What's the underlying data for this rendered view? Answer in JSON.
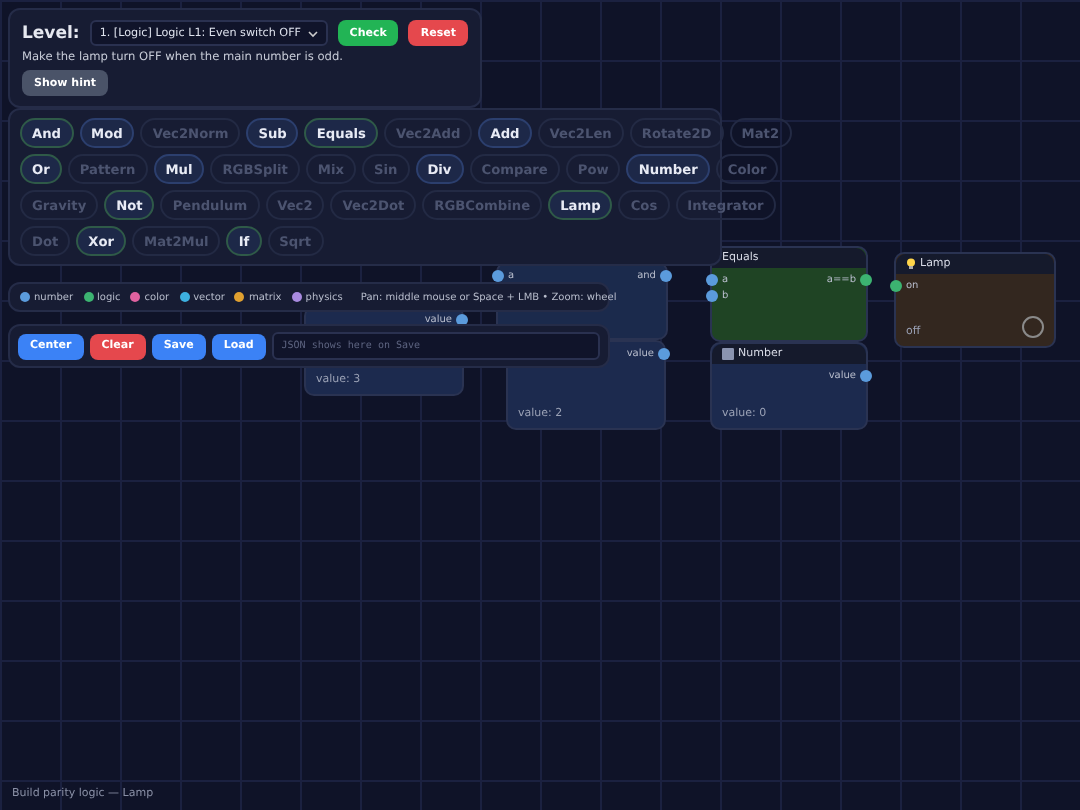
{
  "level": {
    "label": "Level:",
    "selected": "1. [Logic] Logic L1: Even switch OFF",
    "check": "Check",
    "reset": "Reset",
    "task": "Make the lamp turn OFF when the main number is odd.",
    "hint_button": "Show hint"
  },
  "palette": [
    [
      {
        "label": "And",
        "disabled": false,
        "color": "#2f5a48"
      },
      {
        "label": "Mod",
        "disabled": false,
        "color": "#2c3f6e"
      },
      {
        "label": "Vec2Norm",
        "disabled": true
      },
      {
        "label": "Sub",
        "disabled": false,
        "color": "#2c3f6e"
      },
      {
        "label": "Equals",
        "disabled": false,
        "color": "#2f5a48"
      },
      {
        "label": "Vec2Add",
        "disabled": true
      },
      {
        "label": "Add",
        "disabled": false,
        "color": "#2c3f6e"
      },
      {
        "label": "Vec2Len",
        "disabled": true
      },
      {
        "label": "Rotate2D",
        "disabled": true
      },
      {
        "label": "Mat2",
        "disabled": true
      }
    ],
    [
      {
        "label": "Or",
        "disabled": false,
        "color": "#2f5a48"
      },
      {
        "label": "Pattern",
        "disabled": true
      },
      {
        "label": "Mul",
        "disabled": false,
        "color": "#2c3f6e"
      },
      {
        "label": "RGBSplit",
        "disabled": true
      },
      {
        "label": "Mix",
        "disabled": true
      },
      {
        "label": "Sin",
        "disabled": true
      },
      {
        "label": "Div",
        "disabled": false,
        "color": "#2c3f6e"
      },
      {
        "label": "Compare",
        "disabled": true
      },
      {
        "label": "Pow",
        "disabled": true
      },
      {
        "label": "Number",
        "disabled": false,
        "color": "#2c3f6e"
      },
      {
        "label": "Color",
        "disabled": true
      }
    ],
    [
      {
        "label": "Gravity",
        "disabled": true
      },
      {
        "label": "Not",
        "disabled": false,
        "color": "#2f5a48"
      },
      {
        "label": "Pendulum",
        "disabled": true
      },
      {
        "label": "Vec2",
        "disabled": true
      },
      {
        "label": "Vec2Dot",
        "disabled": true
      },
      {
        "label": "RGBCombine",
        "disabled": true
      },
      {
        "label": "Lamp",
        "disabled": false,
        "color": "#2f5a48"
      },
      {
        "label": "Cos",
        "disabled": true
      },
      {
        "label": "Integrator",
        "disabled": true
      }
    ],
    [
      {
        "label": "Dot",
        "disabled": true
      },
      {
        "label": "Xor",
        "disabled": false,
        "color": "#2f5a48"
      },
      {
        "label": "Mat2Mul",
        "disabled": true
      },
      {
        "label": "If",
        "disabled": false,
        "color": "#2f5a48"
      },
      {
        "label": "Sqrt",
        "disabled": true
      }
    ]
  ],
  "legend": [
    {
      "label": "number",
      "color": "#5b9bdc"
    },
    {
      "label": "logic",
      "color": "#3cb371"
    },
    {
      "label": "color",
      "color": "#e062a0"
    },
    {
      "label": "vector",
      "color": "#3db0e0"
    },
    {
      "label": "matrix",
      "color": "#e0a030"
    },
    {
      "label": "physics",
      "color": "#a98be0"
    }
  ],
  "legend_hint": "Pan: middle mouse or Space + LMB • Zoom: wheel",
  "toolbar": {
    "buttons": [
      {
        "label": "Center",
        "kind": "primary"
      },
      {
        "label": "Clear",
        "kind": "danger"
      },
      {
        "label": "Save",
        "kind": "primary"
      },
      {
        "label": "Load",
        "kind": "primary"
      }
    ],
    "placeholder": "JSON shows here on Save"
  },
  "nodes": [
    {
      "kind": "number",
      "outputs": [
        {
          "label": "value",
          "color": "#5b9bdc"
        }
      ],
      "footer": "value: 3"
    },
    {
      "kind": "op",
      "inputs": [
        {
          "label": "a",
          "color": "#5b9bdc"
        }
      ],
      "outputs": [
        {
          "label": "and",
          "color": "#5b9bdc"
        }
      ]
    },
    {
      "kind": "number",
      "outputs": [
        {
          "label": "value",
          "color": "#5b9bdc"
        }
      ],
      "footer": "value: 2"
    },
    {
      "kind": "logic",
      "title": "Equals",
      "inputs": [
        {
          "label": "a",
          "color": "#5b9bdc"
        },
        {
          "label": "b",
          "color": "#5b9bdc"
        }
      ],
      "outputs": [
        {
          "label": "a==b",
          "color": "#3cb371"
        }
      ]
    },
    {
      "kind": "number",
      "title": "Number",
      "outputs": [
        {
          "label": "value",
          "color": "#5b9bdc"
        }
      ],
      "footer": "value: 0"
    },
    {
      "kind": "lamp",
      "title": "Lamp",
      "inputs": [
        {
          "label": "on",
          "color": "#3cb371"
        }
      ],
      "footer": "off",
      "lit": false
    }
  ],
  "status": "Build parity logic — Lamp"
}
